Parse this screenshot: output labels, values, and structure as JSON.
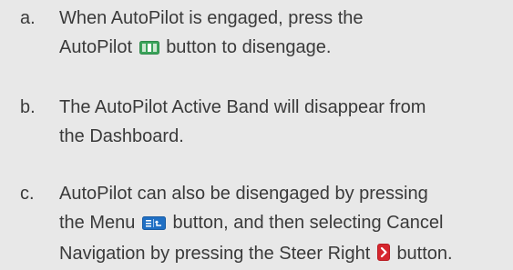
{
  "steps": [
    {
      "marker": "a.",
      "line1": "When AutoPilot is engaged, press the",
      "line2_before": "AutoPilot",
      "line2_icon": "autopilot-button-icon",
      "line2_after": "button to disengage."
    },
    {
      "marker": "b.",
      "line1": "The AutoPilot Active Band will disappear from",
      "line2": "the Dashboard."
    },
    {
      "marker": "c.",
      "line1": "AutoPilot can also be disengaged by pressing",
      "line2_before": "the Menu",
      "line2_icon": "menu-button-icon",
      "line2_after": "button, and then selecting Cancel",
      "line3_before": "Navigation by pressing the Steer Right",
      "line3_icon": "steer-right-button-icon",
      "line3_after": "button."
    }
  ],
  "colors": {
    "background": "#e8e8e8",
    "text": "#3a3a3a",
    "autopilot_icon": "#3aa35a",
    "menu_icon": "#1f6fc4",
    "steer_right_icon": "#d6262e"
  }
}
